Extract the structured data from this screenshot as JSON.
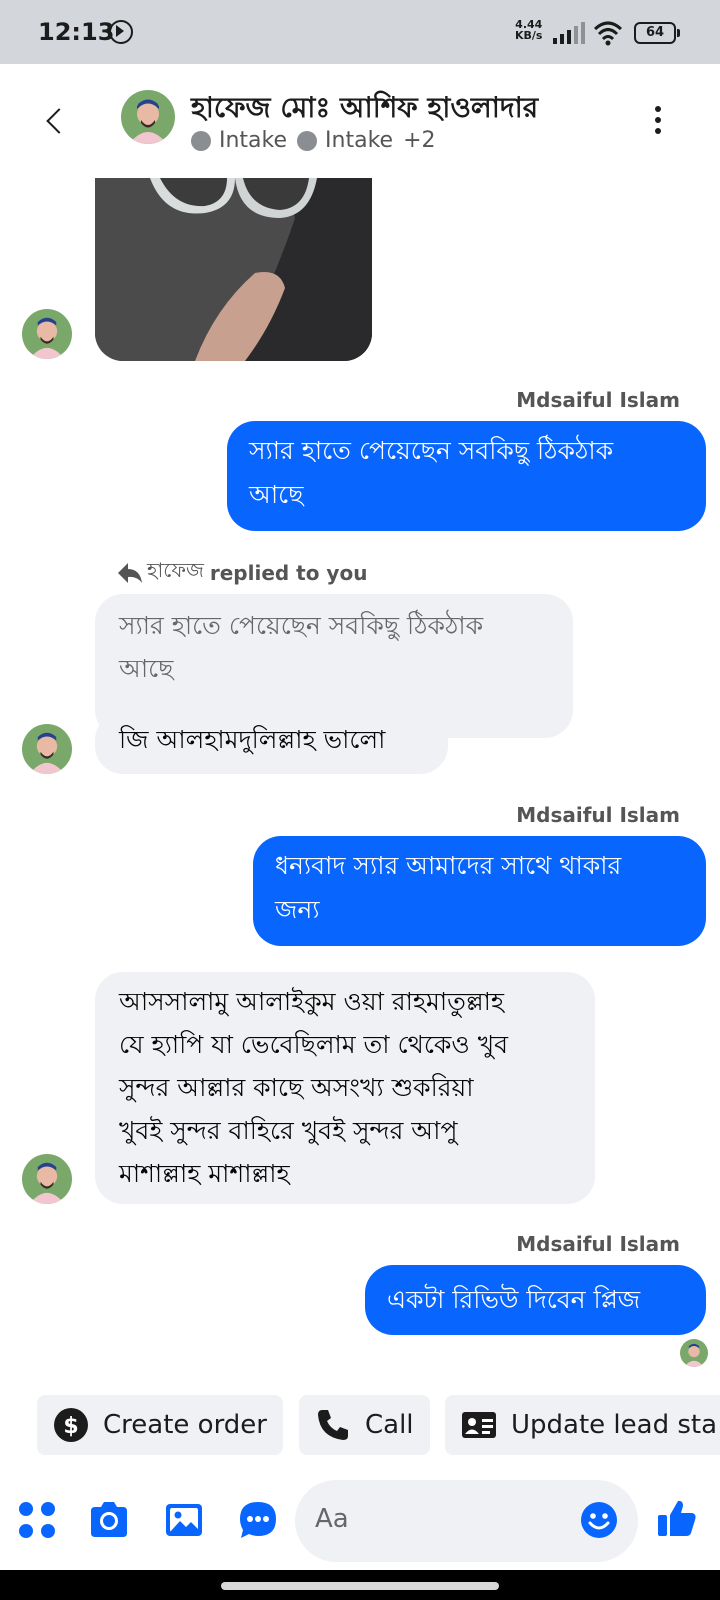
{
  "status_bar": {
    "time": "12:13",
    "net_speed_value": "4.44",
    "net_speed_unit": "KB/s",
    "battery": "64"
  },
  "header": {
    "contact_name": "হাফেজ মোঃ আশিফ হাওলাদার",
    "tags": [
      "Intake",
      "Intake"
    ],
    "more_tags": "+2"
  },
  "messages": {
    "sender_1": "Mdsaiful Islam",
    "out_1_line1": "স্যার হাতে পেয়েছেন সবকিছু ঠিকঠাক",
    "out_1_line2": "আছে",
    "reply_who": "হাফেজ",
    "reply_note": "replied to you",
    "quote_line1": "স্যার হাতে পেয়েছেন সবকিছু ঠিকঠাক",
    "quote_line2": "আছে",
    "in_1": "জি আলহামদুলিল্লাহ ভালো",
    "sender_2": "Mdsaiful Islam",
    "out_2_line1": "ধন্যবাদ স্যার আমাদের সাথে থাকার",
    "out_2_line2": "জন্য",
    "in_2_lines": [
      "আসসালামু আলাইকুম ওয়া রাহমাতুল্লাহ",
      "যে হ্যাপি যা ভেবেছিলাম তা থেকেও খুব",
      "সুন্দর আল্লার কাছে অসংখ্য শুকরিয়া",
      "খুবই সুন্দর বাহিরে খুবই সুন্দর আপু",
      "মাশাল্লাহ মাশাল্লাহ"
    ],
    "sender_3": "Mdsaiful Islam",
    "out_3": "একটা রিভিউ দিবেন প্লিজ"
  },
  "actions": {
    "create_order": "Create order",
    "call": "Call",
    "update_lead": "Update lead sta"
  },
  "composer": {
    "placeholder": "Aa"
  },
  "colors": {
    "accent": "#0866ff",
    "incoming_bubble": "#f0f1f4"
  },
  "icons": [
    "dnd-icon",
    "signal-icon",
    "wifi-icon",
    "battery-icon",
    "back-icon",
    "more-icon",
    "reply-icon",
    "dollar-icon",
    "phone-icon",
    "contact-card-icon",
    "apps-icon",
    "camera-icon",
    "gallery-icon",
    "chat-bubble-icon",
    "emoji-icon",
    "thumbs-up-icon"
  ]
}
